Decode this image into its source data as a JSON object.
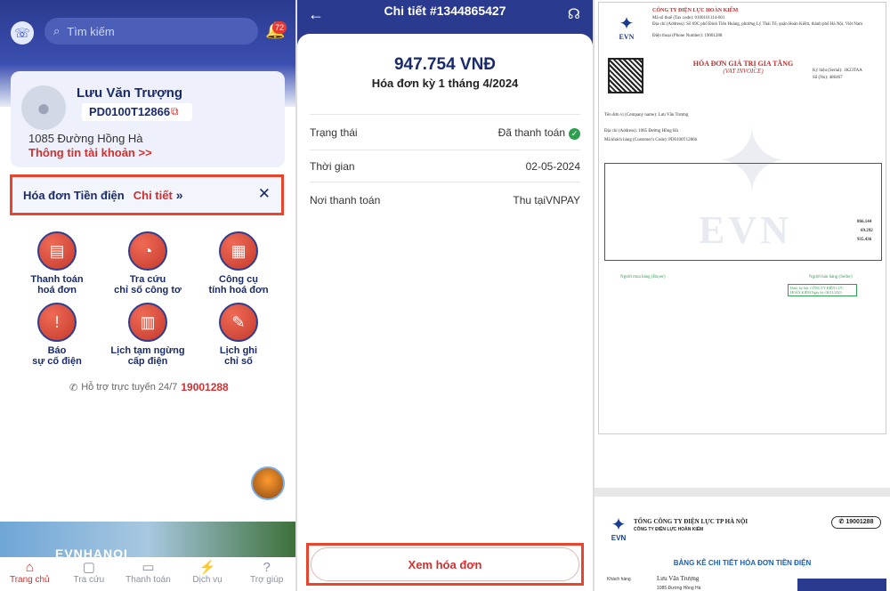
{
  "home": {
    "search_placeholder": "Tìm kiếm",
    "notification_count": "72",
    "user": {
      "name": "Lưu Văn Trượng",
      "code": "PD0100T12866",
      "address": "1085 Đường Hồng Hà",
      "account_link": "Thông tin tài khoản >>"
    },
    "bill_bar": {
      "title": "Hóa đơn Tiền điện",
      "detail": "Chi tiết",
      "arrow": "»",
      "close": "✕"
    },
    "services": [
      {
        "line1": "Thanh toán",
        "line2": "hoá đơn"
      },
      {
        "line1": "Tra cứu",
        "line2": "chỉ số công tơ"
      },
      {
        "line1": "Công cụ",
        "line2": "tính hoá đơn"
      },
      {
        "line1": "Báo",
        "line2": "sự cố điện"
      },
      {
        "line1": "Lịch tạm ngừng",
        "line2": "cấp điện"
      },
      {
        "line1": "Lịch ghi",
        "line2": "chỉ số"
      }
    ],
    "hotline_label": "Hỗ trợ trực tuyến 24/7",
    "hotline_number": "19001288",
    "banner_text": "EVNHANOI",
    "tabs": [
      "Trang chủ",
      "Tra cứu",
      "Thanh toán",
      "Dịch vụ",
      "Trợ giúp"
    ]
  },
  "detail": {
    "title": "Chi tiết #1344865427",
    "amount": "947.754 VNĐ",
    "period": "Hóa đơn kỳ 1 tháng 4/2024",
    "rows": [
      {
        "label": "Trạng thái",
        "value": "Đã thanh toán"
      },
      {
        "label": "Thời gian",
        "value": "02-05-2024"
      },
      {
        "label": "Nơi thanh toán",
        "value": "Thu tạiVNPAY"
      }
    ],
    "button": "Xem hóa đơn"
  },
  "invoice": {
    "company": "CÔNG TY ĐIỆN LỰC HOÀN KIẾM",
    "tax_code": "Mã số thuế (Tax code): 0100101114-001",
    "address": "Địa chỉ (Address): Số 69C phố Đinh Tiên Hoàng, phường Lý Thái Tổ, quận Hoàn Kiếm, thành phố Hà Nội, Việt Nam",
    "phone": "Điện thoại (Phone Number): 19001288",
    "title": "HÓA ĐƠN GIÁ TRỊ GIA TĂNG",
    "title_en": "(VAT INVOICE)",
    "serial": "Ký hiệu (Serial): 1K23TAA",
    "number": "Số (No): 486467",
    "buyer": "Tên đơn vị (Company name): Lưu Văn Trượng",
    "buyer_addr": "Địa chỉ (Address): 1085 Đường Hồng Hà",
    "customer_code": "Mã khách hàng (Customer's Code): PD0100T12866",
    "total_amount": "866.144",
    "vat": "69.292",
    "total_payment": "935.436",
    "seller_label": "Người bán hàng (Seller)",
    "buyer_label": "Người mua hàng (Buyer)",
    "sign_text": "Được ký bởi: CÔNG TY ĐIỆN LỰC HOÀN KIẾM Ngày ký: 08/11/2023",
    "watermark": "EVN",
    "logo_text": "EVN"
  },
  "invoice2": {
    "company": "TỔNG CÔNG TY ĐIỆN LỰC TP HÀ NỘI",
    "sub_company": "CÔNG TY ĐIỆN LỰC HOÀN KIẾM",
    "phone": "19001288",
    "title": "BẢNG KÊ CHI TIẾT HÓA ĐƠN TIỀN ĐIỆN",
    "customer_label": "Khách hàng",
    "customer": "Lưu Văn Trượng",
    "addr": "1085 Đường Hồng Hà"
  }
}
